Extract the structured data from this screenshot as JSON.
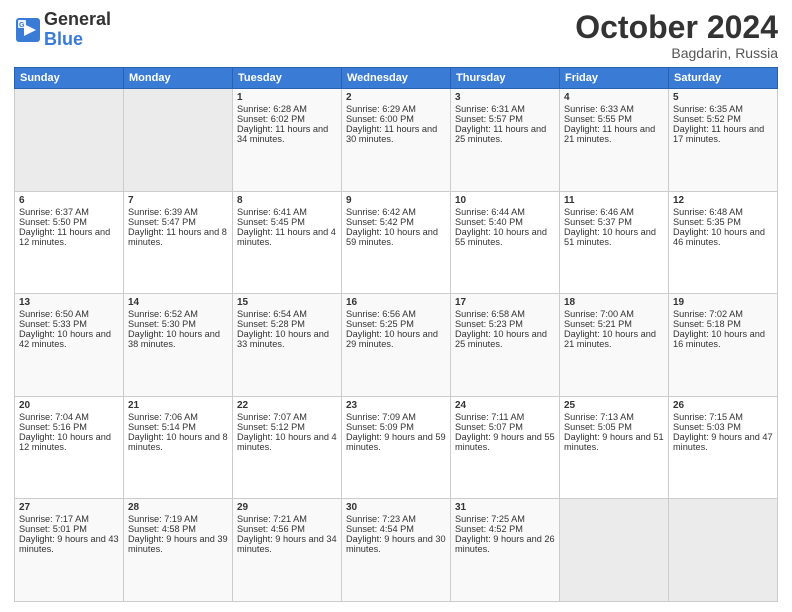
{
  "header": {
    "logo_general": "General",
    "logo_blue": "Blue",
    "month_title": "October 2024",
    "subtitle": "Bagdarin, Russia"
  },
  "days_of_week": [
    "Sunday",
    "Monday",
    "Tuesday",
    "Wednesday",
    "Thursday",
    "Friday",
    "Saturday"
  ],
  "weeks": [
    {
      "days": [
        {
          "num": "",
          "info": "",
          "empty": true
        },
        {
          "num": "",
          "info": "",
          "empty": true
        },
        {
          "num": "1",
          "info": "Sunrise: 6:28 AM\nSunset: 6:02 PM\nDaylight: 11 hours and 34 minutes."
        },
        {
          "num": "2",
          "info": "Sunrise: 6:29 AM\nSunset: 6:00 PM\nDaylight: 11 hours and 30 minutes."
        },
        {
          "num": "3",
          "info": "Sunrise: 6:31 AM\nSunset: 5:57 PM\nDaylight: 11 hours and 25 minutes."
        },
        {
          "num": "4",
          "info": "Sunrise: 6:33 AM\nSunset: 5:55 PM\nDaylight: 11 hours and 21 minutes."
        },
        {
          "num": "5",
          "info": "Sunrise: 6:35 AM\nSunset: 5:52 PM\nDaylight: 11 hours and 17 minutes."
        }
      ]
    },
    {
      "days": [
        {
          "num": "6",
          "info": "Sunrise: 6:37 AM\nSunset: 5:50 PM\nDaylight: 11 hours and 12 minutes."
        },
        {
          "num": "7",
          "info": "Sunrise: 6:39 AM\nSunset: 5:47 PM\nDaylight: 11 hours and 8 minutes."
        },
        {
          "num": "8",
          "info": "Sunrise: 6:41 AM\nSunset: 5:45 PM\nDaylight: 11 hours and 4 minutes."
        },
        {
          "num": "9",
          "info": "Sunrise: 6:42 AM\nSunset: 5:42 PM\nDaylight: 10 hours and 59 minutes."
        },
        {
          "num": "10",
          "info": "Sunrise: 6:44 AM\nSunset: 5:40 PM\nDaylight: 10 hours and 55 minutes."
        },
        {
          "num": "11",
          "info": "Sunrise: 6:46 AM\nSunset: 5:37 PM\nDaylight: 10 hours and 51 minutes."
        },
        {
          "num": "12",
          "info": "Sunrise: 6:48 AM\nSunset: 5:35 PM\nDaylight: 10 hours and 46 minutes."
        }
      ]
    },
    {
      "days": [
        {
          "num": "13",
          "info": "Sunrise: 6:50 AM\nSunset: 5:33 PM\nDaylight: 10 hours and 42 minutes."
        },
        {
          "num": "14",
          "info": "Sunrise: 6:52 AM\nSunset: 5:30 PM\nDaylight: 10 hours and 38 minutes."
        },
        {
          "num": "15",
          "info": "Sunrise: 6:54 AM\nSunset: 5:28 PM\nDaylight: 10 hours and 33 minutes."
        },
        {
          "num": "16",
          "info": "Sunrise: 6:56 AM\nSunset: 5:25 PM\nDaylight: 10 hours and 29 minutes."
        },
        {
          "num": "17",
          "info": "Sunrise: 6:58 AM\nSunset: 5:23 PM\nDaylight: 10 hours and 25 minutes."
        },
        {
          "num": "18",
          "info": "Sunrise: 7:00 AM\nSunset: 5:21 PM\nDaylight: 10 hours and 21 minutes."
        },
        {
          "num": "19",
          "info": "Sunrise: 7:02 AM\nSunset: 5:18 PM\nDaylight: 10 hours and 16 minutes."
        }
      ]
    },
    {
      "days": [
        {
          "num": "20",
          "info": "Sunrise: 7:04 AM\nSunset: 5:16 PM\nDaylight: 10 hours and 12 minutes."
        },
        {
          "num": "21",
          "info": "Sunrise: 7:06 AM\nSunset: 5:14 PM\nDaylight: 10 hours and 8 minutes."
        },
        {
          "num": "22",
          "info": "Sunrise: 7:07 AM\nSunset: 5:12 PM\nDaylight: 10 hours and 4 minutes."
        },
        {
          "num": "23",
          "info": "Sunrise: 7:09 AM\nSunset: 5:09 PM\nDaylight: 9 hours and 59 minutes."
        },
        {
          "num": "24",
          "info": "Sunrise: 7:11 AM\nSunset: 5:07 PM\nDaylight: 9 hours and 55 minutes."
        },
        {
          "num": "25",
          "info": "Sunrise: 7:13 AM\nSunset: 5:05 PM\nDaylight: 9 hours and 51 minutes."
        },
        {
          "num": "26",
          "info": "Sunrise: 7:15 AM\nSunset: 5:03 PM\nDaylight: 9 hours and 47 minutes."
        }
      ]
    },
    {
      "days": [
        {
          "num": "27",
          "info": "Sunrise: 7:17 AM\nSunset: 5:01 PM\nDaylight: 9 hours and 43 minutes."
        },
        {
          "num": "28",
          "info": "Sunrise: 7:19 AM\nSunset: 4:58 PM\nDaylight: 9 hours and 39 minutes."
        },
        {
          "num": "29",
          "info": "Sunrise: 7:21 AM\nSunset: 4:56 PM\nDaylight: 9 hours and 34 minutes."
        },
        {
          "num": "30",
          "info": "Sunrise: 7:23 AM\nSunset: 4:54 PM\nDaylight: 9 hours and 30 minutes."
        },
        {
          "num": "31",
          "info": "Sunrise: 7:25 AM\nSunset: 4:52 PM\nDaylight: 9 hours and 26 minutes."
        },
        {
          "num": "",
          "info": "",
          "empty": true
        },
        {
          "num": "",
          "info": "",
          "empty": true
        }
      ]
    }
  ]
}
